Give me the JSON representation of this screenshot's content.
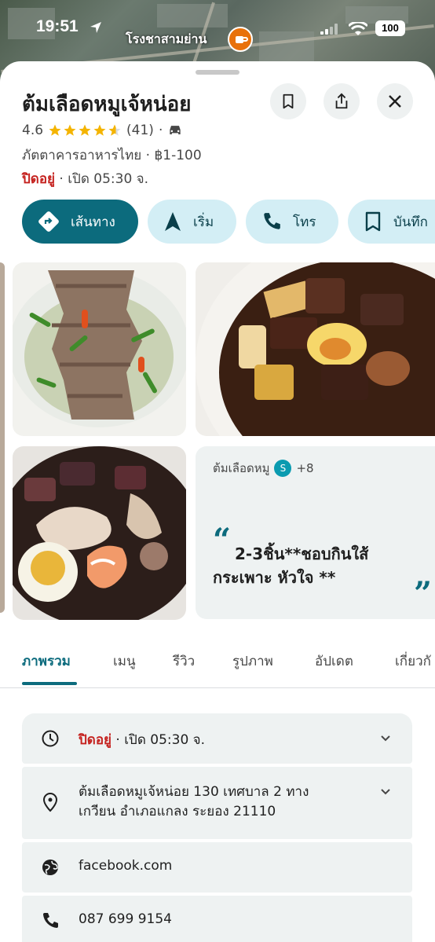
{
  "status": {
    "time": "19:51",
    "place_label": "โรงชาสามย่าน",
    "battery": "100"
  },
  "place": {
    "name": "ต้มเลือดหมูเจ้หน่อย",
    "rating": "4.6",
    "rating_value": 4.6,
    "review_count": "(41)",
    "category_price": "ภัตตาคารอาหารไทย · ฿1-100",
    "status_closed": "ปิดอยู่",
    "opens_text": " · เปิด 05:30 จ."
  },
  "actions": {
    "directions": "เส้นทาง",
    "start": "เริ่ม",
    "call": "โทร",
    "save": "บันทึก"
  },
  "review": {
    "topic": "ต้มเลือดหมู",
    "avatar_letter": "S",
    "extra_count": "+8",
    "quote_open": "“",
    "quote_close": "”",
    "quote_line1": "2-3ชิ้น**ชอบกินใส้",
    "quote_line2": "กระเพาะ หัวใจ **"
  },
  "tabs": [
    "ภาพรวม",
    "เมนู",
    "รีวิว",
    "รูปภาพ",
    "อัปเดต",
    "เกี่ยวกั"
  ],
  "info": {
    "hours_closed": "ปิดอยู่",
    "hours_open": " · เปิด 05:30 จ.",
    "address_line1": "ต้มเลือดหมูเจ้หน่อย 130 เทศบาล 2 ทาง",
    "address_line2": "เกวียน อำเภอแกลง ระยอง 21110",
    "website": "facebook.com",
    "phone": "087 699 9154"
  },
  "colors": {
    "accent": "#0c6b7d",
    "chip_bg": "#d3eef5",
    "closed_red": "#c5221f",
    "star": "#f4b400"
  }
}
